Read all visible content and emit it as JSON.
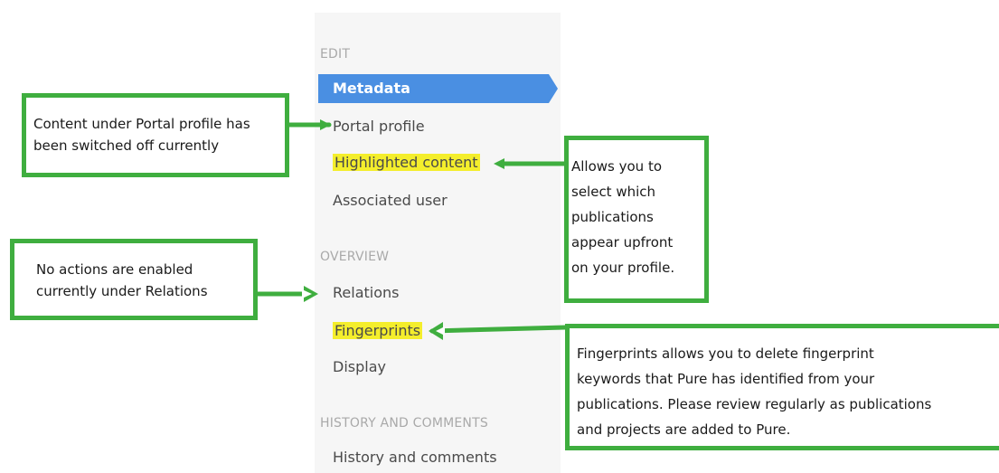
{
  "sidebar": {
    "sections": {
      "edit": "EDIT",
      "overview": "OVERVIEW",
      "history": "HISTORY AND COMMENTS"
    },
    "items": {
      "metadata": "Metadata",
      "portal_profile": "Portal profile",
      "highlighted_content": "Highlighted content",
      "associated_user": "Associated user",
      "relations": "Relations",
      "fingerprints": "Fingerprints",
      "display": "Display",
      "history_comments": "History and comments"
    }
  },
  "callouts": {
    "portal": [
      "Content under Portal profile has",
      "been switched off currently"
    ],
    "relations": [
      "No actions are enabled",
      "currently under Relations"
    ],
    "highlighted": [
      "Allows you to",
      "select which",
      "publications",
      "appear upfront",
      "on your profile."
    ],
    "fingerprints": [
      "Fingerprints allows you to delete fingerprint",
      "keywords that Pure has identified from your",
      "publications. Please review regularly as publications",
      "and projects are added to Pure."
    ]
  },
  "colors": {
    "callout_border": "#3fae3f",
    "highlight": "#f4ee2c",
    "active_nav": "#4a8fe2"
  }
}
